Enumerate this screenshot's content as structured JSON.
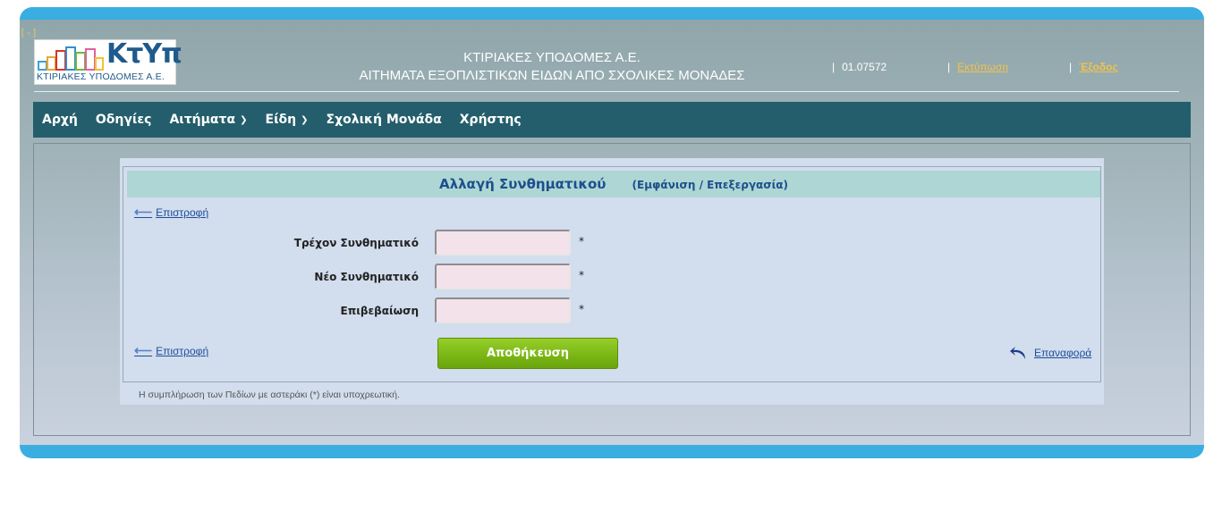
{
  "header": {
    "collapse_label": "[-]",
    "logo_brand": "ΚτΥπ",
    "logo_subtitle": "ΚΤΙΡΙΑΚΕΣ ΥΠΟΔΟΜΕΣ Α.Ε.",
    "title_line1": "ΚΤΙΡΙΑΚΕΣ ΥΠΟΔΟΜΕΣ Α.Ε.",
    "title_line2": "ΑΙΤΗΜΑΤΑ ΕΞΟΠΛΙΣΤΙΚΩΝ ΕΙΔΩΝ ΑΠΟ ΣΧΟΛΙΚΕΣ ΜΟΝΑΔΕΣ",
    "separator": "|",
    "user_code": "01.07572",
    "print_label": "Εκτύπωση",
    "logout_label": "Έξοδος",
    "colors": {
      "frame": "#3aaee0",
      "link": "#f2c24b"
    }
  },
  "nav": {
    "items": [
      {
        "label": "Αρχή",
        "dropdown": false
      },
      {
        "label": "Οδηγίες",
        "dropdown": false
      },
      {
        "label": "Αιτήματα",
        "dropdown": true
      },
      {
        "label": "Είδη",
        "dropdown": true
      },
      {
        "label": "Σχολική Μονάδα",
        "dropdown": false
      },
      {
        "label": "Χρήστης",
        "dropdown": false
      }
    ],
    "color": "#245e6c"
  },
  "form": {
    "title": "Αλλαγή Συνθηματικού",
    "mode": "(Εμφάνιση / Επεξεργασία)",
    "back_label": "Επιστροφή",
    "fields": [
      {
        "label": "Τρέχον Συνθηματικό",
        "value": "",
        "required": "*"
      },
      {
        "label": "Νέο Συνθηματικό",
        "value": "",
        "required": "*"
      },
      {
        "label": "Επιβεβαίωση",
        "value": "",
        "required": "*"
      }
    ],
    "save_label": "Αποθήκευση",
    "reset_label": "Επαναφορά",
    "footnote": "Η συμπλήρωση των Πεδίων με αστεράκι (*) είναι υποχρεωτική.",
    "colors": {
      "save": "#7ab515",
      "title_bar": "#aed6d4",
      "input_bg": "#f4e2ea"
    }
  }
}
